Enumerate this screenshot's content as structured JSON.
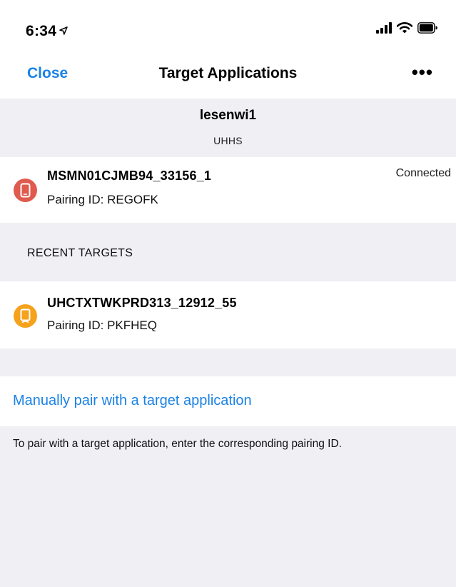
{
  "status_bar": {
    "time": "6:34",
    "location_icon": "location-arrow-icon",
    "icons": [
      "signal-bars-icon",
      "wifi-icon",
      "battery-icon"
    ]
  },
  "nav": {
    "close_label": "Close",
    "title": "Target Applications",
    "more_label": "•••"
  },
  "account": {
    "username": "lesenwi1",
    "organization": "UHHS"
  },
  "connected_target": {
    "name": "MSMN01CJMB94_33156_1",
    "pairing_id": "Pairing ID: REGOFK",
    "status": "Connected",
    "icon": "mobile-device-icon",
    "icon_color": "#e05a4e"
  },
  "recent_section": {
    "label": "RECENT TARGETS"
  },
  "recent_targets": [
    {
      "name": "UHCTXTWKPRD313_12912_55",
      "pairing_id": "Pairing ID: PKFHEQ",
      "icon": "tablet-device-icon",
      "icon_color": "#f5a21c"
    }
  ],
  "manual_pair": {
    "link_label": "Manually pair with a target application"
  },
  "instructions": {
    "text": "To pair with a target application, enter the corresponding pairing ID."
  },
  "colors": {
    "accent": "#1a82e6",
    "band_background": "#efeff4"
  }
}
